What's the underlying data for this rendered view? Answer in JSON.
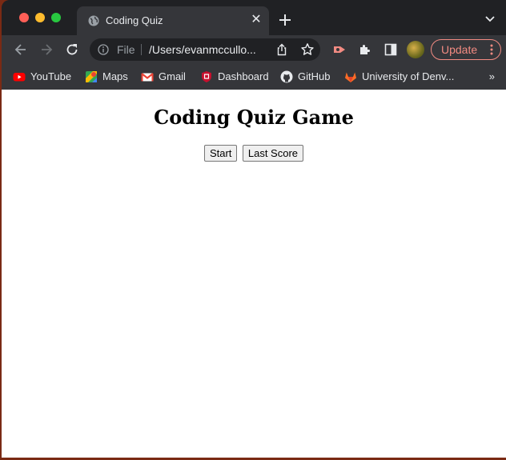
{
  "browser": {
    "tab_title": "Coding Quiz",
    "omnibox": {
      "scheme_label": "File",
      "url": "/Users/evanmccullo..."
    },
    "update_label": "Update",
    "bookmarks": [
      {
        "label": "YouTube",
        "icon": "youtube-icon"
      },
      {
        "label": "Maps",
        "icon": "maps-icon"
      },
      {
        "label": "Gmail",
        "icon": "gmail-icon"
      },
      {
        "label": "Dashboard",
        "icon": "dashboard-shield-icon"
      },
      {
        "label": "GitHub",
        "icon": "github-icon"
      },
      {
        "label": "University of Denv...",
        "icon": "gitlab-icon"
      }
    ],
    "bookmarks_overflow": "»"
  },
  "page": {
    "heading": "Coding Quiz Game",
    "start_button": "Start",
    "last_score_button": "Last Score"
  },
  "colors": {
    "chrome_dark": "#202124",
    "toolbar": "#35363a",
    "update_accent": "#f28b82"
  }
}
